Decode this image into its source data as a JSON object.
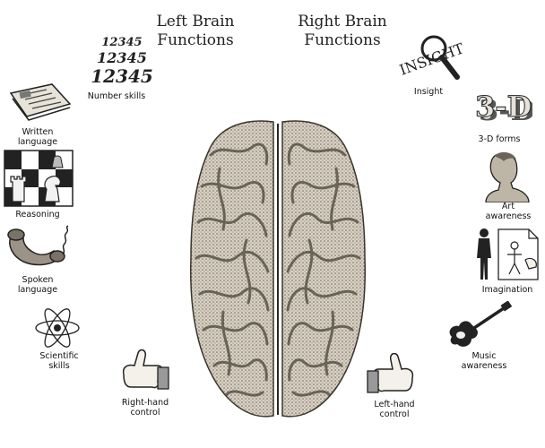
{
  "headings": {
    "left": [
      "Left Brain",
      "Functions"
    ],
    "right": [
      "Right Brain",
      "Functions"
    ]
  },
  "left_functions": [
    {
      "label": [
        "Number skills"
      ],
      "icon": "numbers-icon",
      "numbers": [
        "12345",
        "12345",
        "12345"
      ]
    },
    {
      "label": [
        "Written",
        "language"
      ],
      "icon": "newspaper-icon"
    },
    {
      "label": [
        "Reasoning"
      ],
      "icon": "chess-icon"
    },
    {
      "label": [
        "Spoken",
        "language"
      ],
      "icon": "telephone-icon"
    },
    {
      "label": [
        "Scientific",
        "skills"
      ],
      "icon": "atom-icon"
    },
    {
      "label": [
        "Right-hand",
        "control"
      ],
      "icon": "thumbs-up-right-hand-icon"
    }
  ],
  "right_functions": [
    {
      "label": [
        "Insight"
      ],
      "icon": "magnifier-icon",
      "icon_text": "INSIGHT"
    },
    {
      "label": [
        "3-D forms"
      ],
      "icon": "3d-letters-icon",
      "icon_text": "3-D"
    },
    {
      "label": [
        "Art",
        "awareness"
      ],
      "icon": "statue-bust-icon"
    },
    {
      "label": [
        "Imagination"
      ],
      "icon": "figure-drawing-icon"
    },
    {
      "label": [
        "Music",
        "awareness"
      ],
      "icon": "guitar-icon"
    },
    {
      "label": [
        "Left-hand",
        "control"
      ],
      "icon": "thumbs-up-left-hand-icon"
    }
  ],
  "colors": {
    "ink": "#1a1a1a",
    "brain_fill": "#cfc7b8",
    "brain_fold": "#8b8273"
  }
}
